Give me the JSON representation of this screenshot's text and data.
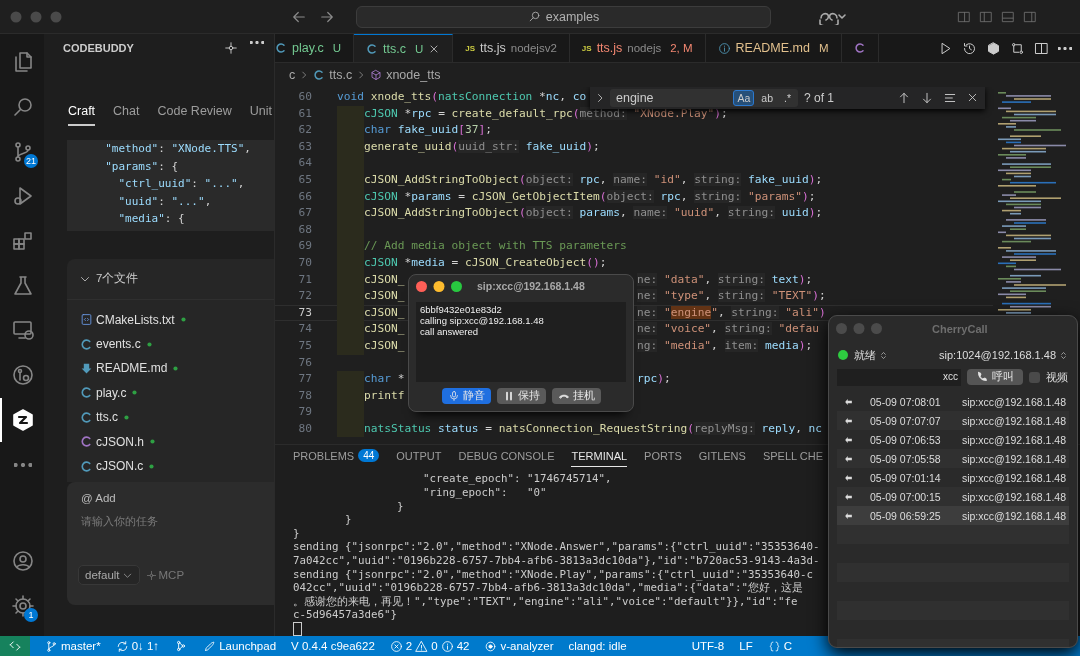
{
  "title_bar": {
    "search": "examples"
  },
  "activity_bar": {
    "items": [
      {
        "kind": "files",
        "selected": false
      },
      {
        "kind": "search",
        "selected": false
      },
      {
        "kind": "source-control",
        "selected": false,
        "badge": "21"
      },
      {
        "kind": "run-debug",
        "selected": false
      },
      {
        "kind": "extensions",
        "selected": false
      },
      {
        "kind": "testing",
        "selected": false
      },
      {
        "kind": "remote",
        "selected": false
      },
      {
        "kind": "gitlens",
        "selected": false
      },
      {
        "kind": "codebuddy",
        "selected": true
      },
      {
        "kind": "more",
        "selected": false
      }
    ],
    "bottom": [
      {
        "kind": "account"
      },
      {
        "kind": "settings",
        "badge": "1"
      }
    ]
  },
  "side_panel": {
    "title": "CODEBUDDY",
    "tabs": [
      {
        "label": "Craft",
        "selected": true
      },
      {
        "label": "Chat",
        "selected": false
      },
      {
        "label": "Code Review",
        "selected": false
      },
      {
        "label": "Unit",
        "selected": false
      }
    ],
    "snippet": [
      "  \"method\": \"XNode.TTS\",",
      "  \"params\": {",
      "    \"ctrl_uuid\": \"...\",",
      "    \"uuid\": \"...\",",
      "    \"media\": {"
    ],
    "files": {
      "header": "7个文件",
      "expanded": true,
      "items": [
        {
          "name": "CMakeLists.txt",
          "kind": "cmake"
        },
        {
          "name": "events.c",
          "kind": "c"
        },
        {
          "name": "README.md",
          "kind": "md"
        },
        {
          "name": "play.c",
          "kind": "c"
        },
        {
          "name": "tts.c",
          "kind": "c"
        },
        {
          "name": "cJSON.h",
          "kind": "h"
        },
        {
          "name": "cJSON.c",
          "kind": "c"
        }
      ]
    },
    "composer": {
      "add": "@ Add",
      "placeholder": "请输入你的任务",
      "mode": "default",
      "mcp": "MCP"
    }
  },
  "editor": {
    "tabs": [
      {
        "label": "play.c",
        "kind": "c",
        "status": "U",
        "color": "#73c991",
        "selected": false
      },
      {
        "label": "tts.c",
        "kind": "c",
        "status": "U",
        "color": "#73c991",
        "selected": true
      },
      {
        "label": "tts.js",
        "kind": "js",
        "icon_text": "JS",
        "detail": "nodejsv2",
        "color": "#cccccc",
        "selected": false
      },
      {
        "label": "tts.js",
        "kind": "js",
        "icon_text": "JS",
        "detail": "nodejs",
        "status": "2, M",
        "color": "#f48771",
        "selected": false
      },
      {
        "label": "README.md",
        "kind": "info",
        "status": "M",
        "color": "#e2c08d",
        "selected": false
      },
      {
        "kind": "h",
        "selected": false
      }
    ],
    "breadcrumb": [
      {
        "label": "c",
        "kind": "folder"
      },
      {
        "label": "tts.c",
        "kind": "c"
      },
      {
        "label": "xnode_tts",
        "kind": "function"
      }
    ],
    "find": {
      "value": "engine",
      "toggles": [
        {
          "label": "Aa",
          "on": true
        },
        {
          "label": "ab",
          "on": false
        },
        {
          "label": ".*",
          "on": false
        }
      ],
      "result": "? of 1"
    },
    "lines": [
      {
        "number": "60",
        "current": false,
        "indented": false,
        "tokens": [
          {
            "text": "void",
            "kind": "kw"
          },
          {
            "text": " xnode_tts",
            "kind": "fn"
          },
          {
            "text": "(",
            "kind": "br"
          },
          {
            "text": "natsConnection",
            "kind": "type"
          },
          {
            "text": " *",
            "kind": "p"
          },
          {
            "text": "nc",
            "kind": "var"
          },
          {
            "text": ", ",
            "kind": "p"
          },
          {
            "text": "co",
            "kind": "var"
          }
        ]
      },
      {
        "number": "61",
        "current": false,
        "indented": true,
        "tokens": [
          {
            "text": "cJSON",
            "kind": "type"
          },
          {
            "text": " *",
            "kind": "p"
          },
          {
            "text": "rpc",
            "kind": "var"
          },
          {
            "text": " = ",
            "kind": "p"
          },
          {
            "text": "create_default_rpc",
            "kind": "fn"
          },
          {
            "text": "(",
            "kind": "br"
          },
          {
            "text": "method:",
            "kind": "hint"
          },
          {
            "text": " \"XNode.Play\"",
            "kind": "str"
          },
          {
            "text": ")",
            "kind": "br"
          },
          {
            "text": ";",
            "kind": "p"
          }
        ]
      },
      {
        "number": "62",
        "current": false,
        "indented": true,
        "tokens": [
          {
            "text": "char",
            "kind": "kw"
          },
          {
            "text": " fake_uuid",
            "kind": "var"
          },
          {
            "text": "[",
            "kind": "br"
          },
          {
            "text": "37",
            "kind": "num"
          },
          {
            "text": "]",
            "kind": "br"
          },
          {
            "text": ";",
            "kind": "p"
          }
        ]
      },
      {
        "number": "63",
        "current": false,
        "indented": true,
        "tokens": [
          {
            "text": "generate_uuid",
            "kind": "fn"
          },
          {
            "text": "(",
            "kind": "br"
          },
          {
            "text": "uuid_str:",
            "kind": "hint"
          },
          {
            "text": " fake_uuid",
            "kind": "var"
          },
          {
            "text": ")",
            "kind": "br"
          },
          {
            "text": ";",
            "kind": "p"
          }
        ]
      },
      {
        "number": "64",
        "current": false,
        "indented": true
      },
      {
        "number": "65",
        "current": false,
        "indented": true,
        "tokens": [
          {
            "text": "cJSON_AddStringToObject",
            "kind": "fn"
          },
          {
            "text": "(",
            "kind": "br"
          },
          {
            "text": "object:",
            "kind": "hint"
          },
          {
            "text": " rpc",
            "kind": "var"
          },
          {
            "text": ", ",
            "kind": "p"
          },
          {
            "text": "name:",
            "kind": "hint"
          },
          {
            "text": " \"id\"",
            "kind": "str"
          },
          {
            "text": ", ",
            "kind": "p"
          },
          {
            "text": "string:",
            "kind": "hint"
          },
          {
            "text": " fake_uuid",
            "kind": "var"
          },
          {
            "text": ")",
            "kind": "br"
          },
          {
            "text": ";",
            "kind": "p"
          }
        ]
      },
      {
        "number": "66",
        "current": false,
        "indented": true,
        "tokens": [
          {
            "text": "cJSON",
            "kind": "type"
          },
          {
            "text": " *",
            "kind": "p"
          },
          {
            "text": "params",
            "kind": "var"
          },
          {
            "text": " = ",
            "kind": "p"
          },
          {
            "text": "cJSON_GetObjectItem",
            "kind": "fn"
          },
          {
            "text": "(",
            "kind": "br"
          },
          {
            "text": "object:",
            "kind": "hint"
          },
          {
            "text": " rpc",
            "kind": "var"
          },
          {
            "text": ", ",
            "kind": "p"
          },
          {
            "text": "string:",
            "kind": "hint"
          },
          {
            "text": " \"params\"",
            "kind": "str"
          },
          {
            "text": ")",
            "kind": "br"
          },
          {
            "text": ";",
            "kind": "p"
          }
        ]
      },
      {
        "number": "67",
        "current": false,
        "indented": true,
        "tokens": [
          {
            "text": "cJSON_AddStringToObject",
            "kind": "fn"
          },
          {
            "text": "(",
            "kind": "br"
          },
          {
            "text": "object:",
            "kind": "hint"
          },
          {
            "text": " params",
            "kind": "var"
          },
          {
            "text": ", ",
            "kind": "p"
          },
          {
            "text": "name:",
            "kind": "hint"
          },
          {
            "text": " \"uuid\"",
            "kind": "str"
          },
          {
            "text": ", ",
            "kind": "p"
          },
          {
            "text": "string:",
            "kind": "hint"
          },
          {
            "text": " uuid",
            "kind": "var"
          },
          {
            "text": ")",
            "kind": "br"
          },
          {
            "text": ";",
            "kind": "p"
          }
        ]
      },
      {
        "number": "68",
        "current": false,
        "indented": true
      },
      {
        "number": "69",
        "current": false,
        "indented": true,
        "tokens": [
          {
            "text": "// Add media object with TTS parameters",
            "kind": "cm"
          }
        ]
      },
      {
        "number": "70",
        "current": false,
        "indented": true,
        "tokens": [
          {
            "text": "cJSON",
            "kind": "type"
          },
          {
            "text": " *",
            "kind": "p"
          },
          {
            "text": "media",
            "kind": "var"
          },
          {
            "text": " = ",
            "kind": "p"
          },
          {
            "text": "cJSON_CreateObject",
            "kind": "fn"
          },
          {
            "text": "()",
            "kind": "br"
          },
          {
            "text": ";",
            "kind": "p"
          }
        ]
      },
      {
        "number": "71",
        "current": false,
        "indented": true,
        "tokens": [
          {
            "text": "cJSON_",
            "kind": "fn"
          }
        ],
        "tail": [
          {
            "text": "ne:",
            "kind": "hint"
          },
          {
            "text": " \"data\"",
            "kind": "str"
          },
          {
            "text": ", ",
            "kind": "p"
          },
          {
            "text": "string:",
            "kind": "hint"
          },
          {
            "text": " text",
            "kind": "var"
          },
          {
            "text": ")",
            "kind": "br"
          },
          {
            "text": ";",
            "kind": "p"
          }
        ]
      },
      {
        "number": "72",
        "current": false,
        "indented": true,
        "tokens": [
          {
            "text": "cJSON_",
            "kind": "fn"
          }
        ],
        "tail": [
          {
            "text": "ne:",
            "kind": "hint"
          },
          {
            "text": " \"type\"",
            "kind": "str"
          },
          {
            "text": ", ",
            "kind": "p"
          },
          {
            "text": "string:",
            "kind": "hint"
          },
          {
            "text": " \"TEXT\"",
            "kind": "str"
          },
          {
            "text": ")",
            "kind": "br"
          },
          {
            "text": ";",
            "kind": "p"
          }
        ]
      },
      {
        "number": "73",
        "current": true,
        "indented": true,
        "tokens": [
          {
            "text": "cJSON_",
            "kind": "fn"
          }
        ],
        "tail": [
          {
            "text": "ne:",
            "kind": "hint"
          },
          {
            "text": " \"",
            "kind": "str"
          },
          {
            "text": "engine",
            "kind": "match"
          },
          {
            "text": "\"",
            "kind": "str"
          },
          {
            "text": ", ",
            "kind": "p"
          },
          {
            "text": "string:",
            "kind": "hint"
          },
          {
            "text": " \"ali\"",
            "kind": "str"
          },
          {
            "text": ")",
            "kind": "br"
          }
        ]
      },
      {
        "number": "74",
        "current": false,
        "indented": true,
        "tokens": [
          {
            "text": "cJSON_",
            "kind": "fn"
          }
        ],
        "tail": [
          {
            "text": "ne:",
            "kind": "hint"
          },
          {
            "text": " \"voice\"",
            "kind": "str"
          },
          {
            "text": ", ",
            "kind": "p"
          },
          {
            "text": "string:",
            "kind": "hint"
          },
          {
            "text": " \"defau",
            "kind": "str"
          }
        ]
      },
      {
        "number": "75",
        "current": false,
        "indented": true,
        "tokens": [
          {
            "text": "cJSON_",
            "kind": "fn"
          }
        ],
        "tail": [
          {
            "text": "ng:",
            "kind": "hint"
          },
          {
            "text": " \"media\"",
            "kind": "str"
          },
          {
            "text": ", ",
            "kind": "p"
          },
          {
            "text": "item:",
            "kind": "hint"
          },
          {
            "text": " media",
            "kind": "var"
          },
          {
            "text": ")",
            "kind": "br"
          },
          {
            "text": ";",
            "kind": "p"
          }
        ]
      },
      {
        "number": "76",
        "current": false,
        "indented": false
      },
      {
        "number": "77",
        "current": false,
        "indented": true,
        "tokens": [
          {
            "text": "char",
            "kind": "kw"
          },
          {
            "text": " *",
            "kind": "p"
          }
        ],
        "tail": [
          {
            "text": "rpc",
            "kind": "var"
          },
          {
            "text": ")",
            "kind": "br"
          },
          {
            "text": ";",
            "kind": "p"
          }
        ]
      },
      {
        "number": "78",
        "current": false,
        "indented": true,
        "tokens": [
          {
            "text": "printf",
            "kind": "fn"
          }
        ]
      },
      {
        "number": "79",
        "current": false,
        "indented": true
      },
      {
        "number": "80",
        "current": false,
        "indented": true,
        "tokens": [
          {
            "text": "natsStatus",
            "kind": "type"
          },
          {
            "text": " status",
            "kind": "var"
          },
          {
            "text": " = ",
            "kind": "p"
          },
          {
            "text": "natsConnection_RequestString",
            "kind": "fn"
          },
          {
            "text": "(",
            "kind": "br"
          },
          {
            "text": "replyMsg:",
            "kind": "hint"
          },
          {
            "text": " reply",
            "kind": "var"
          },
          {
            "text": ", ",
            "kind": "p"
          },
          {
            "text": "nc",
            "kind": "var"
          }
        ]
      }
    ]
  },
  "panel": {
    "tabs": [
      {
        "label": "PROBLEMS",
        "badge": "44",
        "selected": false
      },
      {
        "label": "OUTPUT",
        "selected": false
      },
      {
        "label": "DEBUG CONSOLE",
        "selected": false
      },
      {
        "label": "TERMINAL",
        "selected": true
      },
      {
        "label": "PORTS",
        "selected": false
      },
      {
        "label": "GITLENS",
        "selected": false
      },
      {
        "label": "SPELL CHE",
        "selected": false
      }
    ],
    "terminal": [
      "                    \"create_epoch\": \"1746745714\",",
      "                    \"ring_epoch\":   \"0\"",
      "                }",
      "        }",
      "}",
      "sending {\"jsonrpc\":\"2.0\",\"method\":\"XNode.Answer\",\"params\":{\"ctrl_uuid\":\"35353640-",
      "7a042cc\",\"uuid\":\"0196b228-6757-7bb4-afb6-3813a3dc10da\"},\"id\":\"b720ac53-9143-4a3d-",
      "sending {\"jsonrpc\":\"2.0\",\"method\":\"XNode.Play\",\"params\":{\"ctrl_uuid\":\"35353640-c",
      "042cc\",\"uuid\":\"0196b228-6757-7bb4-afb6-3813a3dc10da\",\"media\":{\"data\":\"您好，这是",
      "。感谢您的来电，再见！\",\"type\":\"TEXT\",\"engine\":\"ali\",\"voice\":\"default\"}},\"id\":\"fe",
      "c-5d96457a3de6\"}"
    ]
  },
  "status_bar": {
    "items": [
      {
        "kind": "remote"
      },
      {
        "kind": "branch",
        "text": "master*"
      },
      {
        "kind": "sync",
        "text": "0↓ 1↑"
      },
      {
        "kind": "graph"
      },
      {
        "kind": "launchpad",
        "text": "Launchpad"
      },
      {
        "kind": "version",
        "text": "V 0.4.4 c9ea622"
      },
      {
        "kind": "problems",
        "errors": "2",
        "warnings": "0",
        "infos": "42"
      },
      {
        "kind": "analyzer",
        "text": "v-analyzer"
      },
      {
        "kind": "plain",
        "text": "clangd: idle"
      },
      {
        "kind": "encoding",
        "text": "UTF-8"
      },
      {
        "kind": "plain",
        "text": "LF"
      },
      {
        "kind": "language",
        "text": "C"
      }
    ]
  },
  "call_popup": {
    "title": "sip:xcc@192.168.1.48",
    "log": [
      "6bbf9432e01e83d2",
      "calling sip:xcc@192.168.1.48",
      "call answered"
    ],
    "buttons": [
      {
        "label": "静音",
        "kind": "mute",
        "active": true
      },
      {
        "label": "保持",
        "kind": "hold",
        "active": false
      },
      {
        "label": "挂机",
        "kind": "hangup",
        "active": false
      }
    ]
  },
  "cherrycall": {
    "title": "CherryCall",
    "status": "就绪",
    "online": true,
    "account": "sip:1024@192.168.1.48",
    "dial": {
      "value": "xcc"
    },
    "call_button": "呼叫",
    "video": {
      "label": "视频",
      "checked": false
    },
    "calls": [
      {
        "time": "05-09 07:08:01",
        "address": "sip:xcc@192.168.1.48",
        "selected": false
      },
      {
        "time": "05-09 07:07:07",
        "address": "sip:xcc@192.168.1.48",
        "selected": false
      },
      {
        "time": "05-09 07:06:53",
        "address": "sip:xcc@192.168.1.48",
        "selected": false
      },
      {
        "time": "05-09 07:05:58",
        "address": "sip:xcc@192.168.1.48",
        "selected": false
      },
      {
        "time": "05-09 07:01:14",
        "address": "sip:xcc@192.168.1.48",
        "selected": false
      },
      {
        "time": "05-09 07:00:15",
        "address": "sip:xcc@192.168.1.48",
        "selected": false
      },
      {
        "time": "05-09 06:59:25",
        "address": "sip:xcc@192.168.1.48",
        "selected": true
      }
    ]
  }
}
